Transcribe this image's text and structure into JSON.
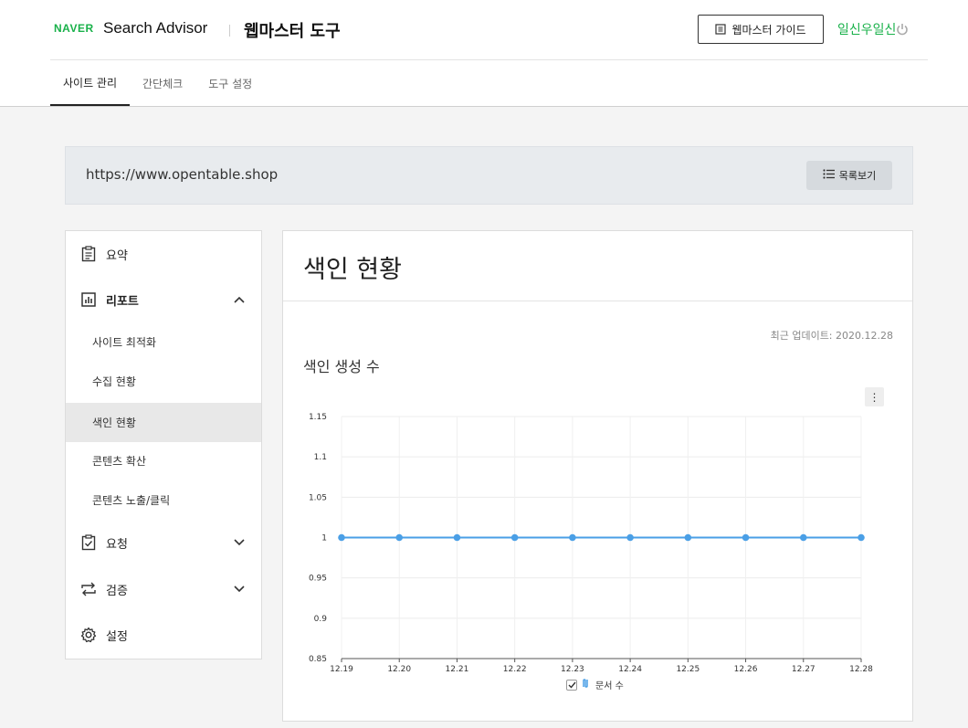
{
  "header": {
    "naver": "NAVER",
    "search_advisor": "Search Advisor",
    "tool_title": "웹마스터 도구",
    "guide_button": "웹마스터 가이드",
    "user_name": "일신우일신"
  },
  "tabs": [
    {
      "label": "사이트 관리",
      "active": true
    },
    {
      "label": "간단체크",
      "active": false
    },
    {
      "label": "도구 설정",
      "active": false
    }
  ],
  "site": {
    "url": "https://www.opentable.shop",
    "list_button": "목록보기"
  },
  "sidebar": {
    "summary": "요약",
    "report": "리포트",
    "report_items": [
      "사이트 최적화",
      "수집 현황",
      "색인 현황",
      "콘텐츠 확산",
      "콘텐츠 노출/클릭"
    ],
    "active_item": "색인 현황",
    "request": "요청",
    "verify": "검증",
    "settings": "설정"
  },
  "panel": {
    "title": "색인 현황",
    "updated": "최근 업데이트: 2020.12.28",
    "chart_title": "색인 생성 수",
    "menu_glyph": "⋮"
  },
  "colors": {
    "brand_green": "#19b14a",
    "series_blue": "#4a9fe6"
  },
  "chart_data": {
    "type": "line",
    "x": [
      "12.19",
      "12.20",
      "12.21",
      "12.22",
      "12.23",
      "12.24",
      "12.25",
      "12.26",
      "12.27",
      "12.28"
    ],
    "series": [
      {
        "name": "문서 수",
        "values": [
          1,
          1,
          1,
          1,
          1,
          1,
          1,
          1,
          1,
          1
        ]
      }
    ],
    "ylim": [
      0.85,
      1.15
    ],
    "yticks": [
      "1.15",
      "1.1",
      "1.05",
      "1",
      "0.95",
      "0.9",
      "0.85"
    ],
    "grid": true,
    "legend": "bottom-center"
  }
}
